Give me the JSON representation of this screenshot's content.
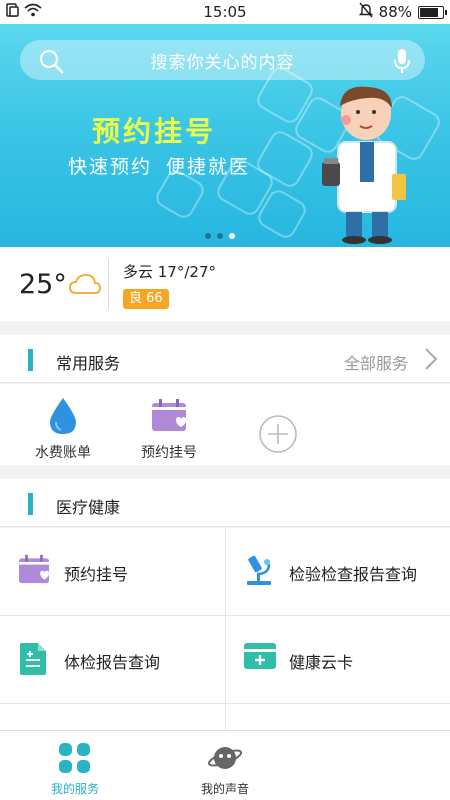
{
  "status_bar": {
    "time": "15:05",
    "battery": "88%",
    "battery_level": 0.88
  },
  "search": {
    "placeholder": "搜索你关心的内容"
  },
  "banner": {
    "title": "预约挂号",
    "subtitle": "快速预约  便捷就医",
    "slide_count": 3,
    "active_slide": 3
  },
  "weather": {
    "temperature": "25°",
    "condition": "多云 17°/27°",
    "aqi": "良 66"
  },
  "common_services": {
    "title": "常用服务",
    "more": "全部服务",
    "items": [
      {
        "label": "水费账单",
        "icon": "water-drop-icon"
      },
      {
        "label": "预约挂号",
        "icon": "calendar-icon"
      }
    ],
    "add_icon": "add-icon"
  },
  "health": {
    "title": "医疗健康",
    "items": [
      {
        "label": "预约挂号",
        "icon": "calendar-icon"
      },
      {
        "label": "检验检查报告查询",
        "icon": "microscope-icon"
      },
      {
        "label": "体检报告查询",
        "icon": "report-icon"
      },
      {
        "label": "健康云卡",
        "icon": "medical-card-icon"
      }
    ]
  },
  "bottom_nav": {
    "items": [
      {
        "label": "我的服务",
        "icon": "grid-icon",
        "active": true
      },
      {
        "label": "我的声音",
        "icon": "planet-icon",
        "active": false
      }
    ]
  },
  "colors": {
    "accent": "#29b3c4",
    "aqi": "#f5a623",
    "banner_title": "#e9ff4a"
  }
}
